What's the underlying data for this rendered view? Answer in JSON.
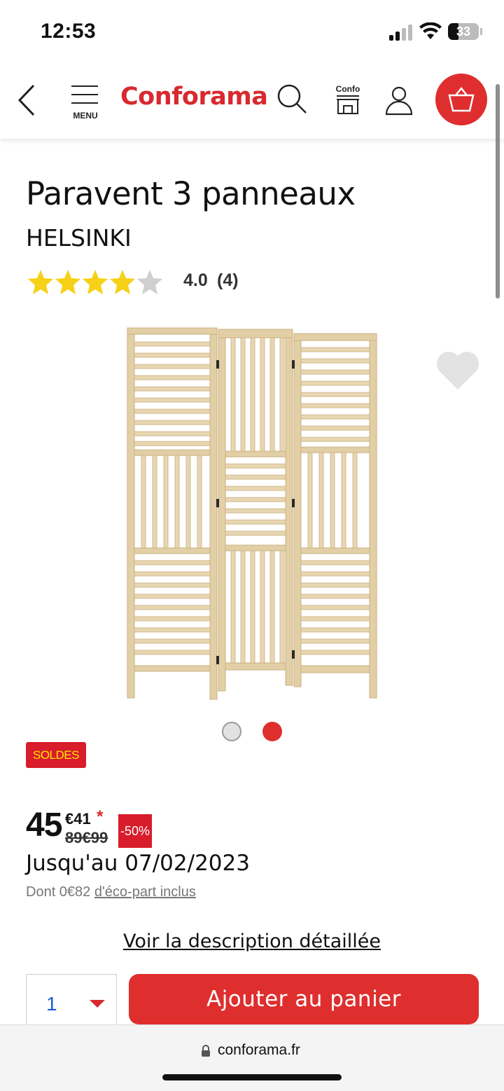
{
  "status_bar": {
    "time": "12:53",
    "battery": "33"
  },
  "header": {
    "menu_label": "MENU",
    "logo": "Conforama",
    "store_label": "Confo"
  },
  "product": {
    "title": "Paravent 3 panneaux",
    "brand": "HELSINKI",
    "rating": {
      "value": "4.0",
      "count": "(4)",
      "stars": 4,
      "max": 5
    },
    "gallery": {
      "images": 2,
      "active_index": 1
    },
    "badge": "SOLDES",
    "price": {
      "integer": "45",
      "cents": "€41",
      "asterisk": "*",
      "old": "89€99",
      "discount": "-50%"
    },
    "valid_until": "Jusqu'au 07/02/2023",
    "eco_part_prefix": "Dont 0€82",
    "eco_part_link": "d'éco-part inclus"
  },
  "actions": {
    "description_link": "Voir la description détaillée",
    "quantity": "1",
    "add_to_cart": "Ajouter au panier"
  },
  "browser": {
    "url": "conforama.fr"
  },
  "colors": {
    "brand_red": "#df2e2e",
    "sale_badge_bg": "#d81c2b",
    "sale_badge_text": "#ffe600",
    "star_filled": "#f7d117",
    "star_empty": "#cfcfcf",
    "wood": "#e3cfa6"
  }
}
